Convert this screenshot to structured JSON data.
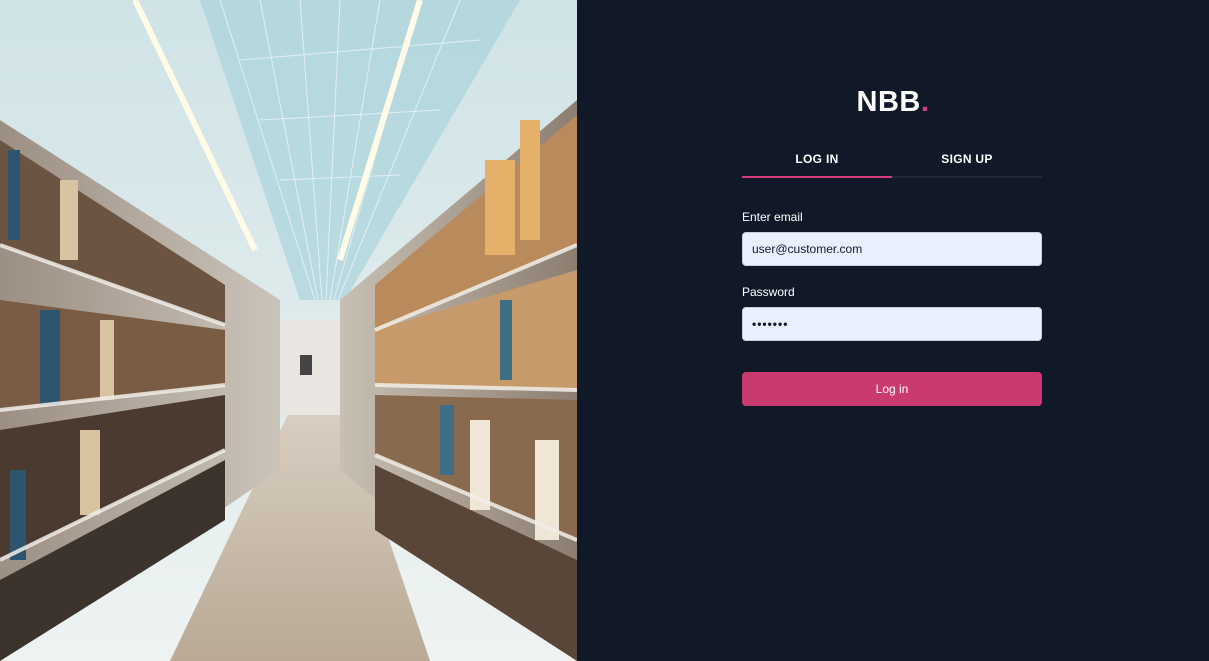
{
  "brand": {
    "name": "NBB",
    "dot": "."
  },
  "tabs": [
    {
      "label": "LOG IN",
      "active": true
    },
    {
      "label": "SIGN UP",
      "active": false
    }
  ],
  "form": {
    "email_label": "Enter email",
    "email_value": "user@customer.com",
    "password_label": "Password",
    "password_value": "•••••••",
    "submit_label": "Log in"
  },
  "colors": {
    "panel_bg": "#111827",
    "accent": "#c93a71",
    "input_bg": "#e8f0fe"
  }
}
